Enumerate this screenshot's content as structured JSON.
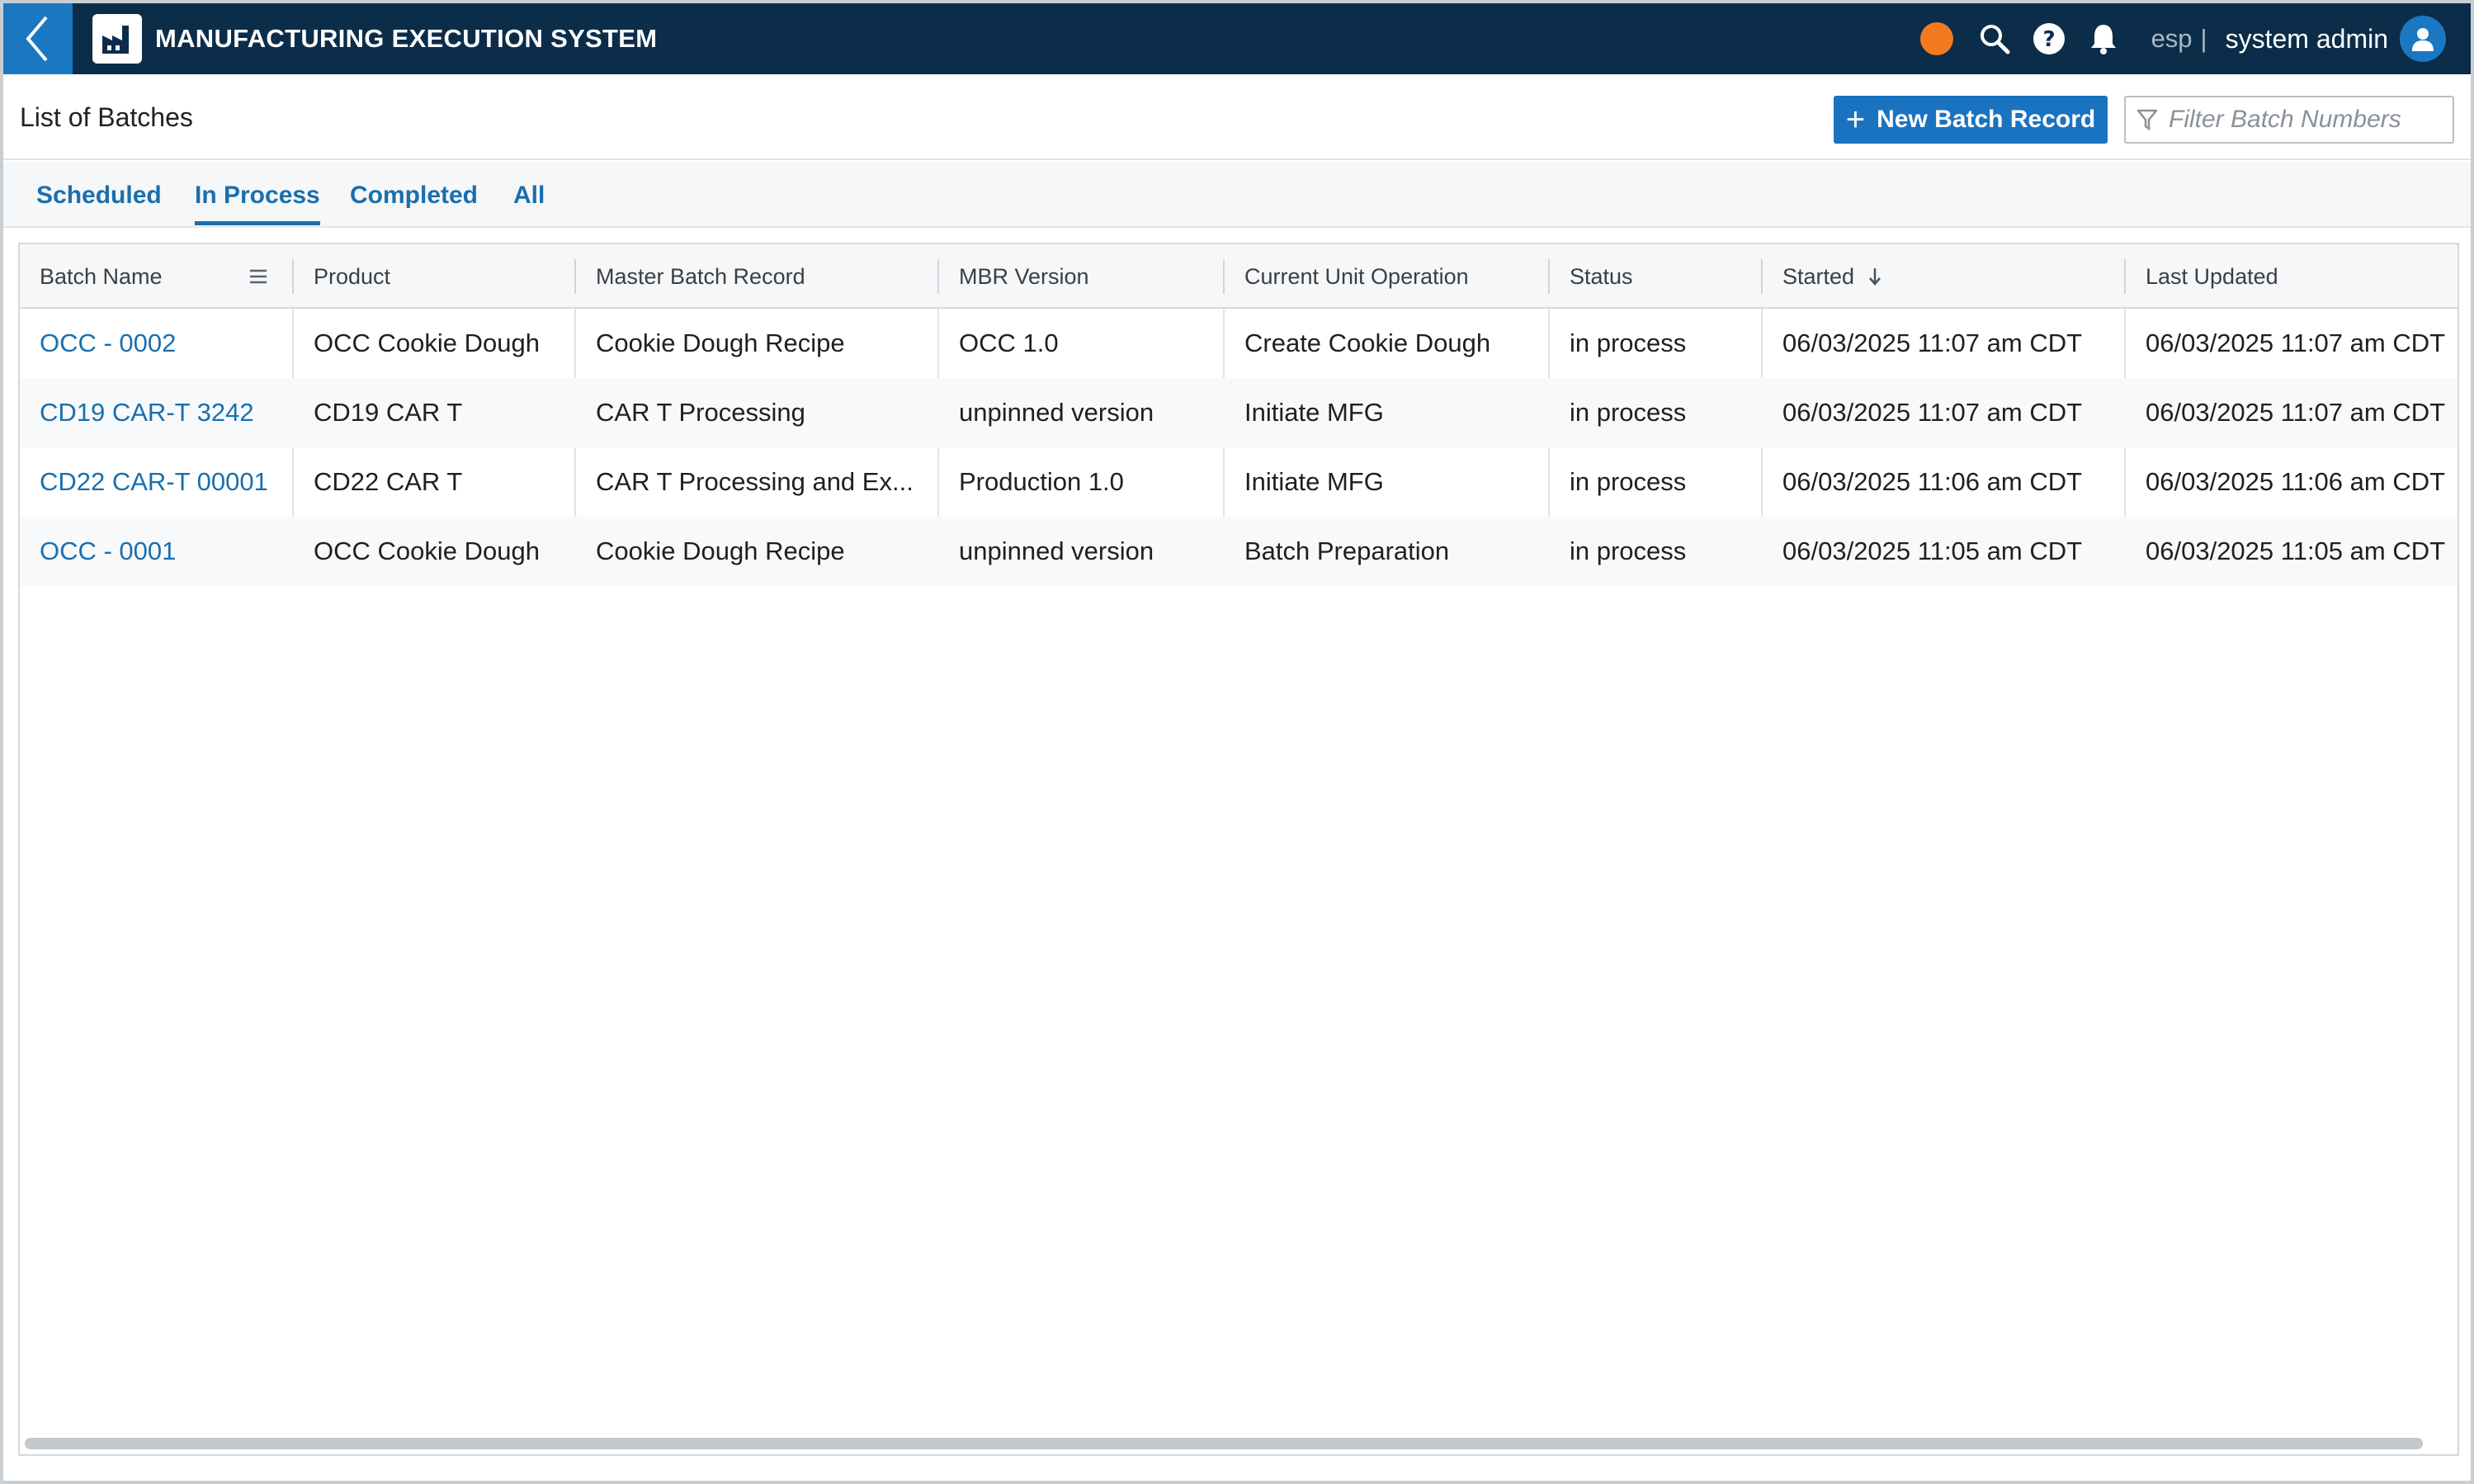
{
  "app": {
    "title": "MANUFACTURING EXECUTION SYSTEM",
    "lang": "esp",
    "separator": "|",
    "user_name": "system admin",
    "status_color": "#f47a1f"
  },
  "icons": {
    "back": "chevron-left-icon",
    "logo": "factory-icon",
    "search": "search-icon",
    "help": "help-icon",
    "notifications": "bell-icon",
    "user": "user-icon",
    "filter": "filter-icon",
    "column_menu": "menu-icon",
    "sort": "arrow-down-icon"
  },
  "header": {
    "page_title": "List of Batches",
    "new_button_label": "New Batch Record",
    "new_button_plus": "+",
    "filter_placeholder": "Filter Batch Numbers"
  },
  "tabs": [
    {
      "label": "Scheduled",
      "active": false
    },
    {
      "label": "In Process",
      "active": true
    },
    {
      "label": "Completed",
      "active": false
    },
    {
      "label": "All",
      "active": false
    }
  ],
  "table": {
    "columns": [
      "Batch Name",
      "Product",
      "Master Batch Record",
      "MBR Version",
      "Current Unit Operation",
      "Status",
      "Started",
      "Last Updated"
    ],
    "rows": [
      [
        "OCC - 0002",
        "OCC Cookie Dough",
        "Cookie Dough Recipe",
        "OCC 1.0",
        "Create Cookie Dough",
        "in process",
        "06/03/2025 11:07 am CDT",
        "06/03/2025 11:07 am CDT"
      ],
      [
        "CD19 CAR-T 3242",
        "CD19 CAR T",
        "CAR T Processing",
        "unpinned version",
        "Initiate MFG",
        "in process",
        "06/03/2025 11:07 am CDT",
        "06/03/2025 11:07 am CDT"
      ],
      [
        "CD22 CAR-T 00001",
        "CD22 CAR T",
        "CAR T Processing and Ex...",
        "Production 1.0",
        "Initiate MFG",
        "in process",
        "06/03/2025 11:06 am CDT",
        "06/03/2025 11:06 am CDT"
      ],
      [
        "OCC - 0001",
        "OCC Cookie Dough",
        "Cookie Dough Recipe",
        "unpinned version",
        "Batch Preparation",
        "in process",
        "06/03/2025 11:05 am CDT",
        "06/03/2025 11:05 am CDT"
      ]
    ]
  },
  "colors": {
    "topbar": "#0b2d4a",
    "accent": "#1a73c0",
    "link": "#1a6fae"
  }
}
